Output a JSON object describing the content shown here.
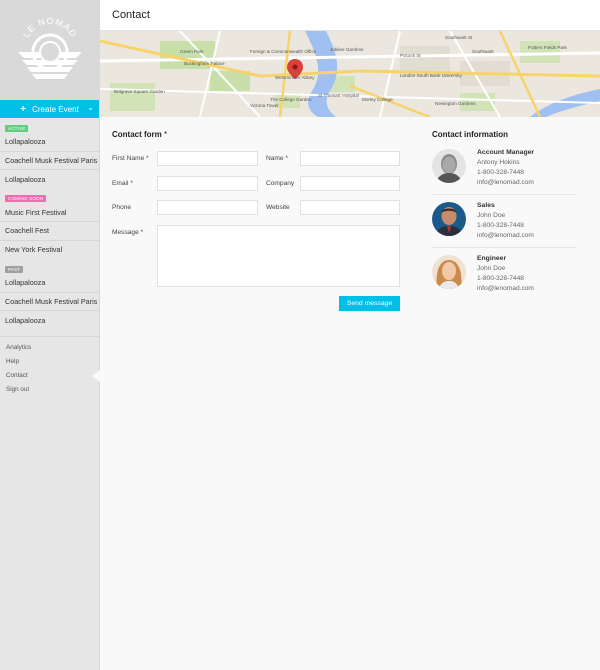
{
  "app": {
    "logo_text": "LE NOMAD",
    "create_event_label": "Create Event"
  },
  "sidebar": {
    "sections": [
      {
        "tag": "ACTIVE",
        "items": [
          "Lollapalooza",
          "Coachell Musk Festival Paris",
          "Lollapalooza"
        ]
      },
      {
        "tag": "COMING SOON",
        "items": [
          "Music First Festival",
          "Coachell Fest",
          "New York Festival"
        ]
      },
      {
        "tag": "PAST",
        "items": [
          "Lollapalooza",
          "Coachell Musk Festival Paris",
          "Lollapalooza"
        ]
      }
    ],
    "nav": [
      "Analytics",
      "Help",
      "Contact",
      "Sign out"
    ]
  },
  "header": {
    "title": "Contact"
  },
  "map": {
    "labels": [
      "Green Park",
      "Buckingham Palace",
      "Belgrave Square Garden",
      "Foreign & Commonwealth Office",
      "Jubilee Gardens",
      "Westminster Abbey",
      "The College Garden",
      "St Thomas' Hospital",
      "London South Bank University",
      "Morley College",
      "Newington Gardens",
      "Southwark St",
      "Southwark",
      "Pocock St",
      "Victoria Tower",
      "Potters Fields Park"
    ]
  },
  "form": {
    "title": "Contact form",
    "required_mark": "*",
    "fields": {
      "first_name": "First Name *",
      "name": "Name *",
      "email": "Email *",
      "company": "Company",
      "phone": "Phone",
      "website": "Website",
      "message": "Message *"
    },
    "values": {
      "first_name": "",
      "name": "",
      "email": "",
      "company": "",
      "phone": "",
      "website": "",
      "message": ""
    },
    "send_label": "Send message"
  },
  "contact_info": {
    "title": "Contact information",
    "people": [
      {
        "role": "Account Manager",
        "name": "Antony Hokins",
        "phone": "1-800-328-7448",
        "email": "info@lenomad.com"
      },
      {
        "role": "Sales",
        "name": "John Doe",
        "phone": "1-800-328-7448",
        "email": "info@lenomad.com"
      },
      {
        "role": "Engineer",
        "name": "John Doe",
        "phone": "1-800-328-7448",
        "email": "info@lenomad.com"
      }
    ]
  },
  "colors": {
    "accent": "#00c0e8",
    "sidebar_bg": "#e6e6e6",
    "tag_active": "#5fcf7b",
    "tag_soon": "#f06ab0",
    "tag_past": "#a0a0a0"
  }
}
